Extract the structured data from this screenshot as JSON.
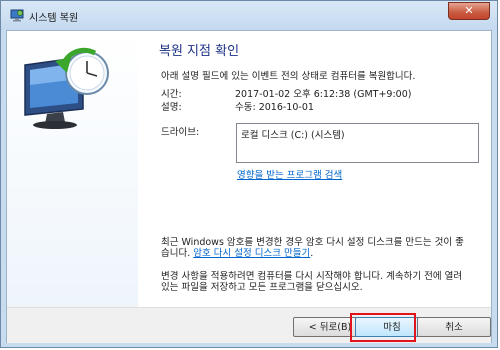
{
  "window": {
    "title": "시스템 복원",
    "close_label": "✕"
  },
  "page": {
    "heading": "복원 지점 확인",
    "description": "아래 설명 필드에 있는 이벤트 전의 상태로 컴퓨터를 복원합니다.",
    "time_label": "시간:",
    "time_value": "2017-01-02 오후 6:12:38 (GMT+9:00)",
    "desc_label": "설명:",
    "desc_value": "수동: 2016-10-01",
    "drives_label": "드라이브:",
    "drives_value": "로컬 디스크 (C:) (시스템)",
    "affected_link": "영향을 받는 프로그램 검색",
    "password_notice_prefix": "최근 Windows 암호를 변경한 경우 암호 다시 설정 디스크를 만드는 것이 좋습니다. ",
    "password_link": "암호 다시 설정 디스크 만들기",
    "password_notice_suffix": ".",
    "restart_notice": "변경 사항을 적용하려면 컴퓨터를 다시 시작해야 합니다. 계속하기 전에 열려 있는 파일을 저장하고 모든 프로그램을 닫으십시오."
  },
  "buttons": {
    "back": "< 뒤로(B)",
    "finish": "마침",
    "cancel": "취소"
  },
  "icons": {
    "title": "system-restore-icon",
    "illustration": "computer-restore-icon"
  },
  "colors": {
    "highlight": "#e0141a",
    "link": "#0066cc",
    "heading": "#1e3287"
  }
}
